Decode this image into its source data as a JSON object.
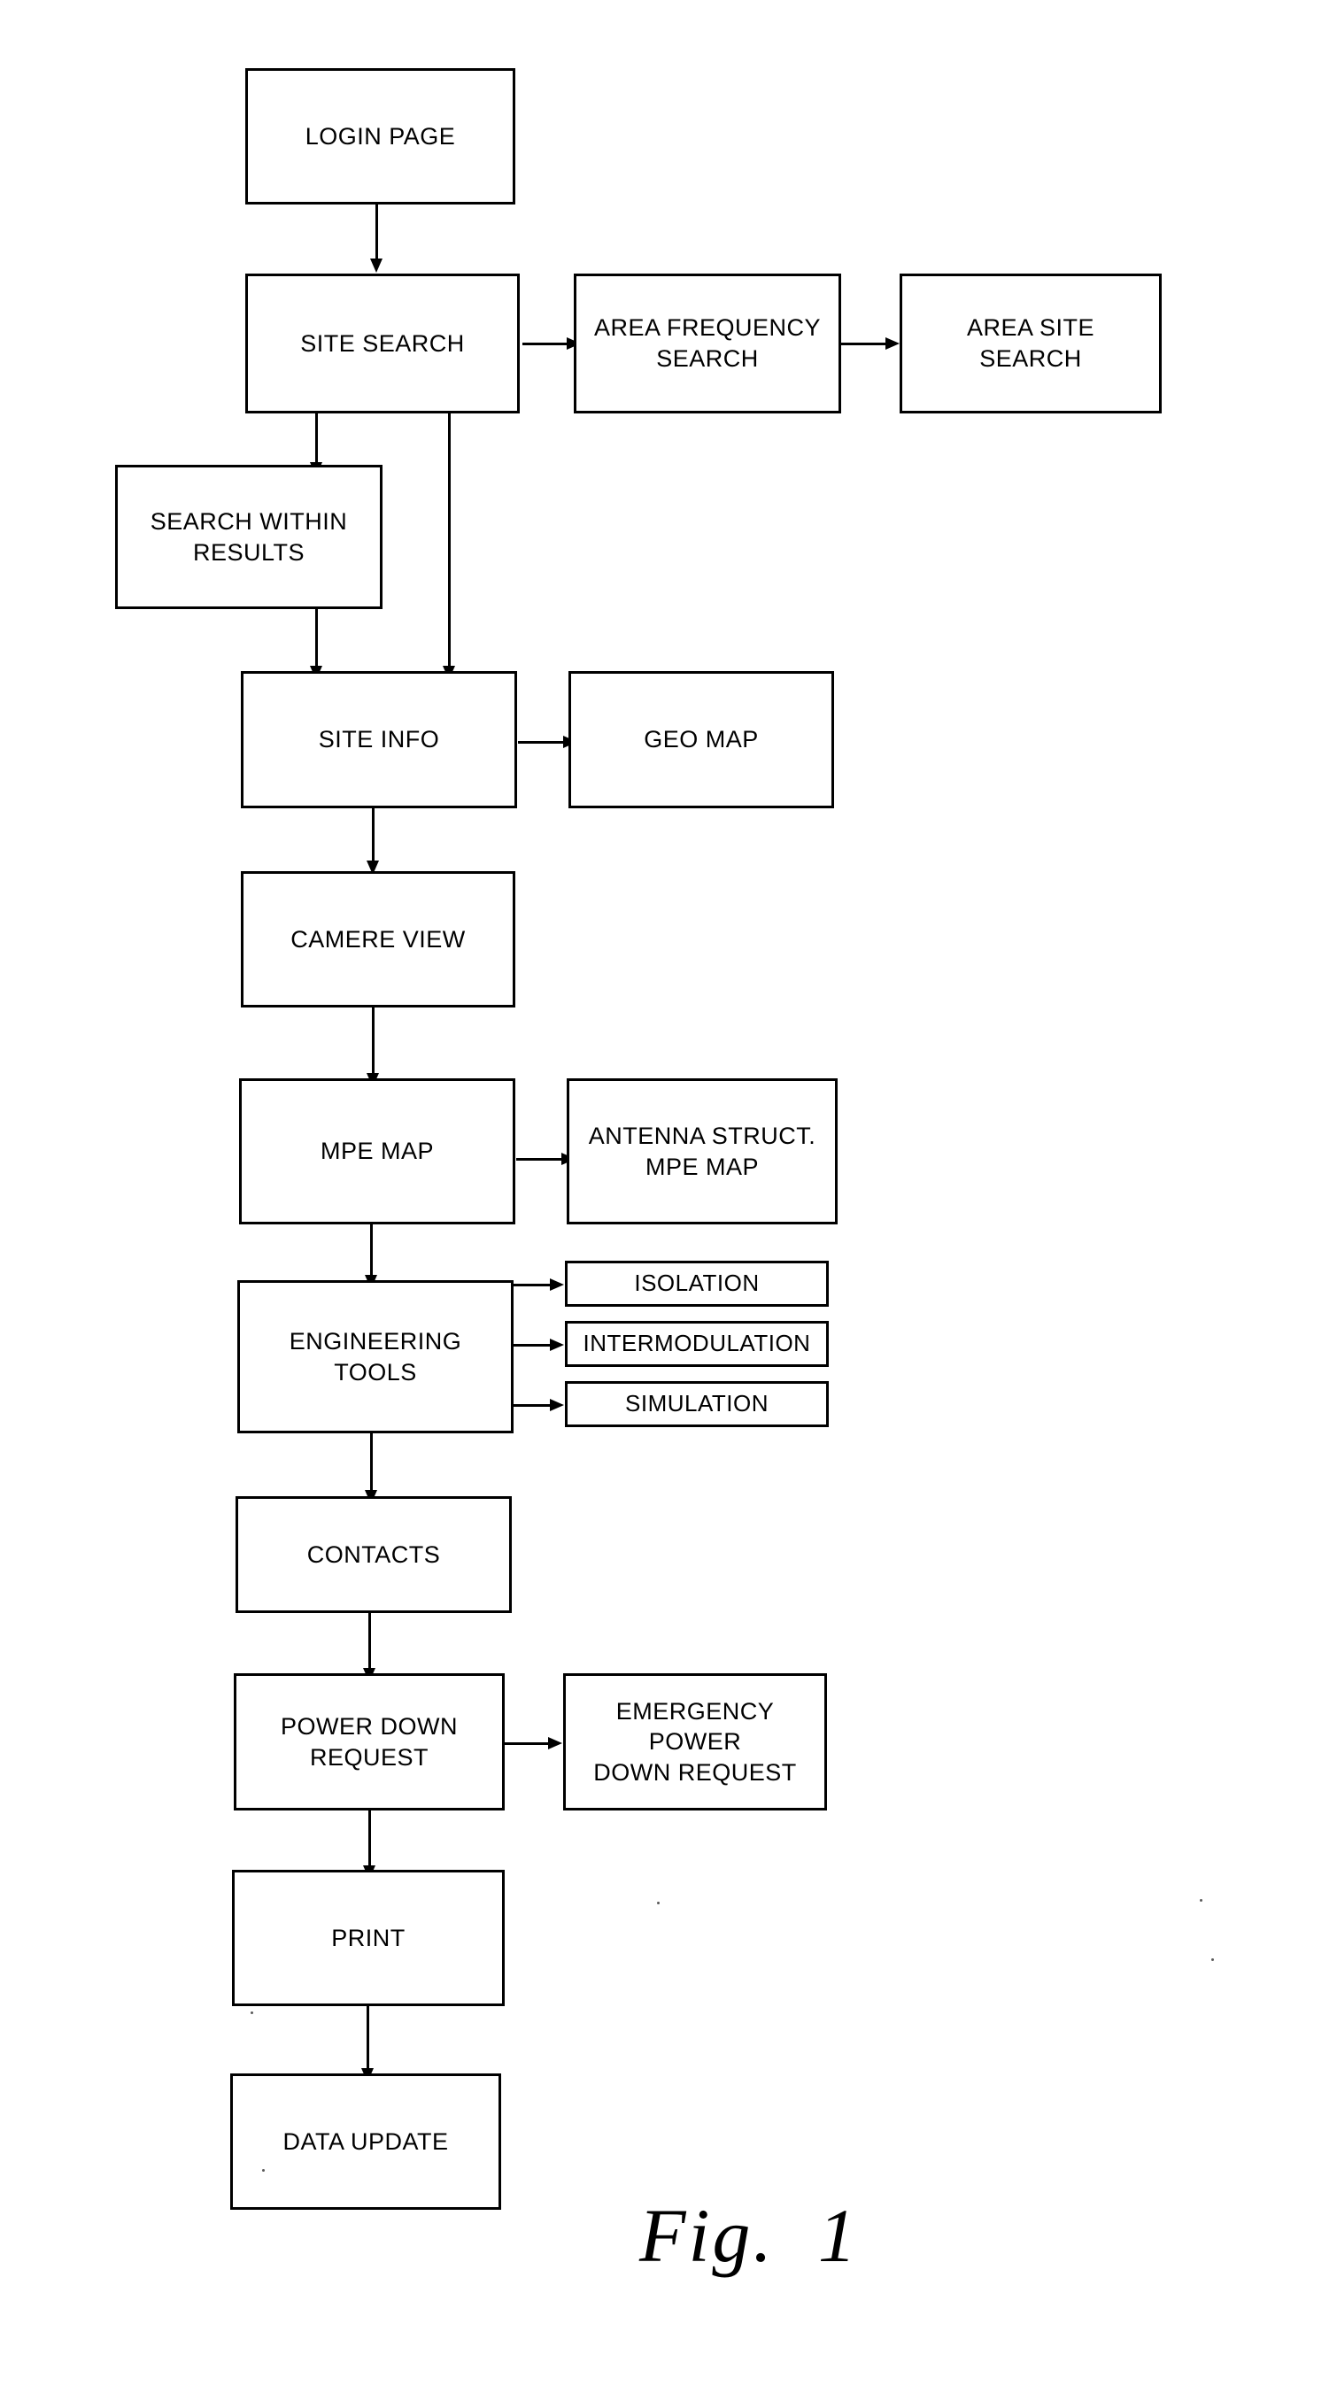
{
  "figure": {
    "caption": "Fig.  1"
  },
  "nodes": [
    {
      "id": "login-page",
      "label": "LOGIN PAGE"
    },
    {
      "id": "site-search",
      "label": "SITE SEARCH"
    },
    {
      "id": "area-frequency-search",
      "label": "AREA FREQUENCY\nSEARCH"
    },
    {
      "id": "area-site-search",
      "label": "AREA SITE\nSEARCH"
    },
    {
      "id": "search-within-results",
      "label": "SEARCH WITHIN\nRESULTS"
    },
    {
      "id": "site-info",
      "label": "SITE INFO"
    },
    {
      "id": "geo-map",
      "label": "GEO MAP"
    },
    {
      "id": "camere-view",
      "label": "CAMERE VIEW"
    },
    {
      "id": "mpe-map",
      "label": "MPE MAP"
    },
    {
      "id": "antenna-struct-mpe-map",
      "label": "ANTENNA STRUCT.\nMPE MAP"
    },
    {
      "id": "engineering-tools",
      "label": "ENGINEERING\nTOOLS"
    },
    {
      "id": "isolation",
      "label": "ISOLATION"
    },
    {
      "id": "intermodulation",
      "label": "INTERMODULATION"
    },
    {
      "id": "simulation",
      "label": "SIMULATION"
    },
    {
      "id": "contacts",
      "label": "CONTACTS"
    },
    {
      "id": "power-down-request",
      "label": "POWER DOWN\nREQUEST"
    },
    {
      "id": "emergency-power-down",
      "label": "EMERGENCY POWER\nDOWN REQUEST"
    },
    {
      "id": "print",
      "label": "PRINT"
    },
    {
      "id": "data-update",
      "label": "DATA UPDATE"
    }
  ],
  "edges": [
    {
      "from": "login-page",
      "to": "site-search"
    },
    {
      "from": "site-search",
      "to": "area-frequency-search"
    },
    {
      "from": "area-frequency-search",
      "to": "area-site-search"
    },
    {
      "from": "site-search",
      "to": "search-within-results"
    },
    {
      "from": "site-search",
      "to": "site-info"
    },
    {
      "from": "search-within-results",
      "to": "site-info"
    },
    {
      "from": "site-info",
      "to": "geo-map"
    },
    {
      "from": "site-info",
      "to": "camere-view"
    },
    {
      "from": "camere-view",
      "to": "mpe-map"
    },
    {
      "from": "mpe-map",
      "to": "antenna-struct-mpe-map"
    },
    {
      "from": "mpe-map",
      "to": "engineering-tools"
    },
    {
      "from": "engineering-tools",
      "to": "isolation"
    },
    {
      "from": "engineering-tools",
      "to": "intermodulation"
    },
    {
      "from": "engineering-tools",
      "to": "simulation"
    },
    {
      "from": "engineering-tools",
      "to": "contacts"
    },
    {
      "from": "contacts",
      "to": "power-down-request"
    },
    {
      "from": "power-down-request",
      "to": "emergency-power-down"
    },
    {
      "from": "power-down-request",
      "to": "print"
    },
    {
      "from": "print",
      "to": "data-update"
    }
  ],
  "colors": {
    "ink": "#000000",
    "paper": "#ffffff"
  }
}
